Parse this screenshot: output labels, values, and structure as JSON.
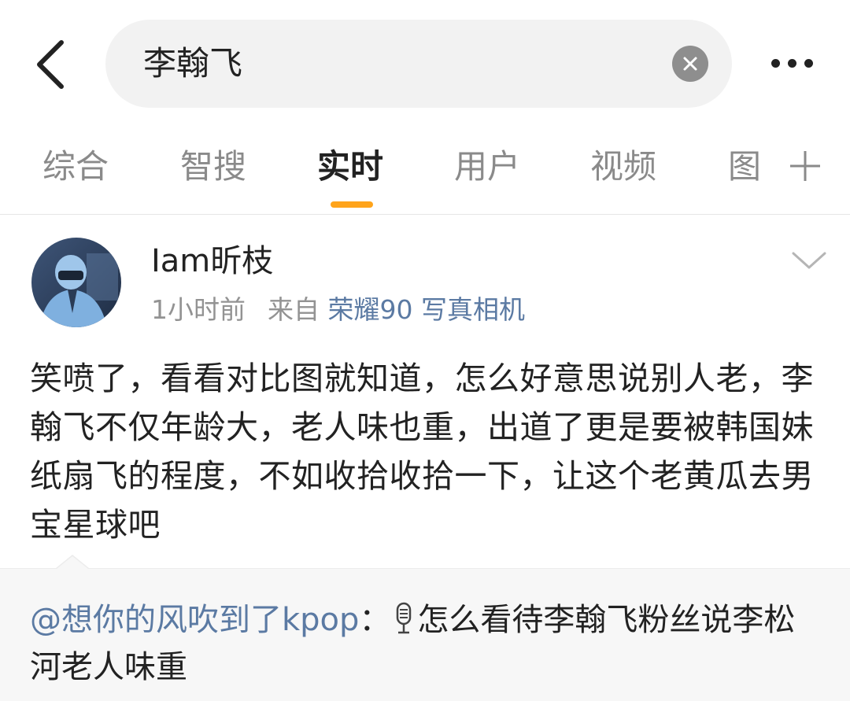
{
  "header": {
    "back_icon": "chevron-left-icon",
    "search_value": "李翰飞",
    "clear_icon": "close-icon",
    "more_icon": "more-horizontal-icon"
  },
  "tabs": [
    {
      "label": "综合",
      "active": false
    },
    {
      "label": "智搜",
      "active": false
    },
    {
      "label": "实时",
      "active": true
    },
    {
      "label": "用户",
      "active": false
    },
    {
      "label": "视频",
      "active": false
    },
    {
      "label": "图",
      "active": false
    }
  ],
  "tab_add_icon": "plus-icon",
  "accent_color": "#ffa41b",
  "link_color": "#5b7aa3",
  "post": {
    "username": "Iam昕枝",
    "time": "1小时前",
    "source_prefix": "来自",
    "device": "荣耀90 写真相机",
    "body": "笑喷了，看看对比图就知道，怎么好意思说别人老，李翰飞不仅年龄大，老人味也重，出道了更是要被韩国妹纸扇飞的程度，不如收拾收拾一下，让这个老黄瓜去男宝星球吧"
  },
  "repost": {
    "mention": "@想你的风吹到了kpop",
    "colon": "：",
    "mic_icon": "microphone-icon",
    "text": "怎么看待李翰飞粉丝说李松河老人味重"
  }
}
